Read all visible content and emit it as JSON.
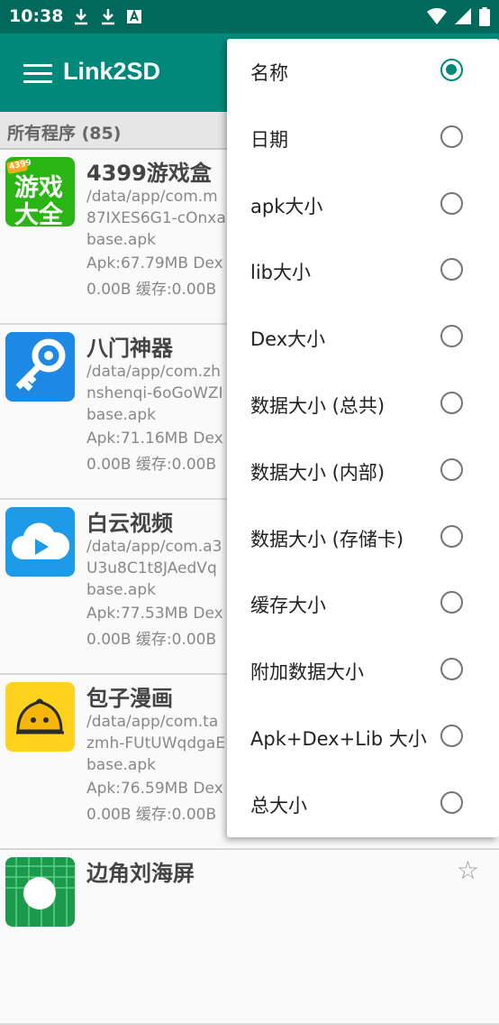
{
  "status_bar": {
    "time": "10:38"
  },
  "toolbar": {
    "title": "Link2SD"
  },
  "list": {
    "header": "所有程序 (85)",
    "apps": [
      {
        "name": "4399游戏盒",
        "path1": "/data/app/com.m",
        "path2": "87IXES6G1-cOnxa",
        "path3": "base.apk",
        "sizes": "Apk:67.79MB  Dex",
        "cache": "0.00B  缓存:0.00B",
        "icon_text1": "游戏",
        "icon_text2": "大全",
        "icon_badge": "4399"
      },
      {
        "name": "八门神器",
        "path1": "/data/app/com.zh",
        "path2": "nshenqi-6oGoWZI",
        "path3": "base.apk",
        "sizes": "Apk:71.16MB  Dex",
        "cache": "0.00B  缓存:0.00B"
      },
      {
        "name": "白云视频",
        "path1": "/data/app/com.a3",
        "path2": "U3u8C1t8JAedVq",
        "path3": "base.apk",
        "sizes": "Apk:77.53MB  Dex",
        "cache": "0.00B  缓存:0.00B"
      },
      {
        "name": "包子漫画",
        "path1": "/data/app/com.ta",
        "path2": "zmh-FUtUWqdgaE",
        "path3": "base.apk",
        "sizes": "Apk:76.59MB  Dex",
        "cache": "0.00B  缓存:0.00B"
      },
      {
        "name": "边角刘海屏"
      }
    ]
  },
  "sort_menu": {
    "selected_index": 0,
    "options": [
      "名称",
      "日期",
      "apk大小",
      "lib大小",
      "Dex大小",
      "数据大小 (总共)",
      "数据大小 (内部)",
      "数据大小 (存储卡)",
      "缓存大小",
      "附加数据大小",
      "Apk+Dex+Lib 大小",
      "总大小"
    ]
  },
  "colors": {
    "primary": "#00897b",
    "primary_dark": "#00695c"
  }
}
